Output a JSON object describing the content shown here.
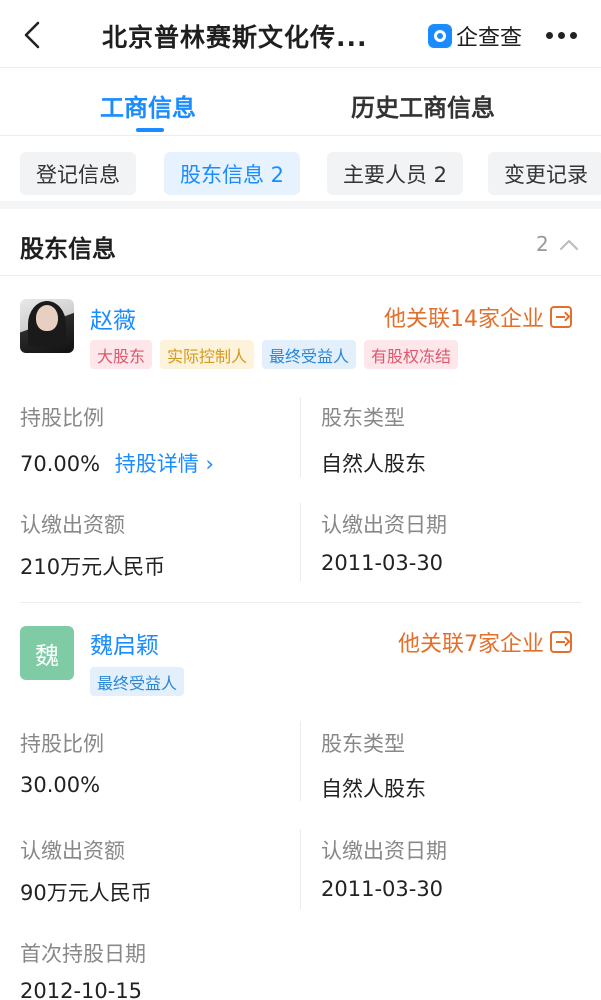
{
  "nav": {
    "title": "北京普林赛斯文化传...",
    "brand": "企查查"
  },
  "tabs": [
    {
      "label": "工商信息",
      "active": true
    },
    {
      "label": "历史工商信息",
      "active": false
    }
  ],
  "chips": [
    {
      "label": "登记信息",
      "active": false
    },
    {
      "label": "股东信息 2",
      "active": true
    },
    {
      "label": "主要人员 2",
      "active": false
    },
    {
      "label": "变更记录",
      "active": false
    }
  ],
  "section": {
    "title": "股东信息",
    "count": "2"
  },
  "labels": {
    "ratio": "持股比例",
    "type": "股东类型",
    "amount": "认缴出资额",
    "date": "认缴出资日期",
    "first_date": "首次持股日期",
    "detail_link": "持股详情"
  },
  "shareholders": [
    {
      "name": "赵薇",
      "related": "他关联14家企业",
      "tags": [
        {
          "label": "大股东",
          "color": "#e0566a",
          "bg": "#fde7ea"
        },
        {
          "label": "实际控制人",
          "color": "#d39a1f",
          "bg": "#fdf2da"
        },
        {
          "label": "最终受益人",
          "color": "#2a86d6",
          "bg": "#e3f0fc"
        },
        {
          "label": "有股权冻结",
          "color": "#e0566a",
          "bg": "#fde7ea"
        }
      ],
      "ratio": "70.00%",
      "type": "自然人股东",
      "amount": "210万元人民币",
      "date": "2011-03-30"
    },
    {
      "name": "魏启颖",
      "avatar_letter": "魏",
      "related": "他关联7家企业",
      "tags": [
        {
          "label": "最终受益人",
          "color": "#2a86d6",
          "bg": "#e3f0fc"
        }
      ],
      "ratio": "30.00%",
      "type": "自然人股东",
      "amount": "90万元人民币",
      "date": "2011-03-30",
      "first_date": "2012-10-15"
    }
  ],
  "colors": {
    "accent": "#1a8cff",
    "related": "#e2702c"
  }
}
